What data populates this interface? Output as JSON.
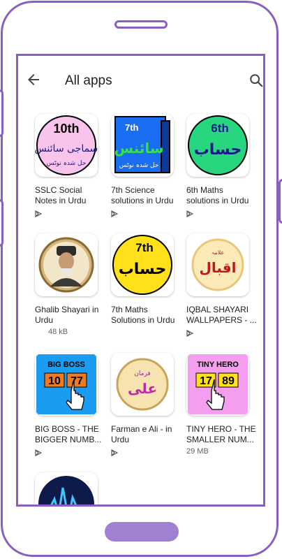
{
  "header": {
    "title": "All apps"
  },
  "apps": [
    {
      "name": "SSLC Social\nNotes in Urdu",
      "meta": ""
    },
    {
      "name": "7th Science\nsolutions in Urdu",
      "meta": ""
    },
    {
      "name": "6th Maths\nsolutions in Urdu",
      "meta": ""
    },
    {
      "name": "Ghalib Shayari in\nUrdu",
      "meta": "48 kB"
    },
    {
      "name": "7th Maths\nSolutions in Urdu",
      "meta": ""
    },
    {
      "name": "IQBAL SHAYARI\nWALLPAPERS - ...",
      "meta": ""
    },
    {
      "name": "BIG BOSS - THE\nBIGGER NUMB...",
      "meta": ""
    },
    {
      "name": "Farman e Ali - in\nUrdu",
      "meta": ""
    },
    {
      "name": "TINY HERO - THE\nSMALLER NUM...",
      "meta": "29 MB"
    }
  ],
  "icon_text": {
    "sslc_grade": "10th",
    "sslc_urdu": "سماجی سائنس",
    "sslc_sub": "حل شدہ نوٹس",
    "sci_grade": "7th",
    "sci_urdu": "سائنس",
    "sci_sub": "حل شدہ نوٹس",
    "m6_grade": "6th",
    "m6_urdu": "حساب",
    "m7_grade": "7th",
    "m7_urdu": "حساب",
    "iqbal_small": "علامہ",
    "iqbal_urdu": "اقبال",
    "bigboss_title": "BIG BOSS",
    "bigboss_a": "10",
    "bigboss_b": "77",
    "tiny_title": "TINY HERO",
    "tiny_a": "17",
    "tiny_b": "89",
    "farman_small": "فرمان",
    "farman_urdu": "علی"
  },
  "colors": {
    "accent": "#8a5fc4",
    "home_button": "#9f82cf"
  }
}
